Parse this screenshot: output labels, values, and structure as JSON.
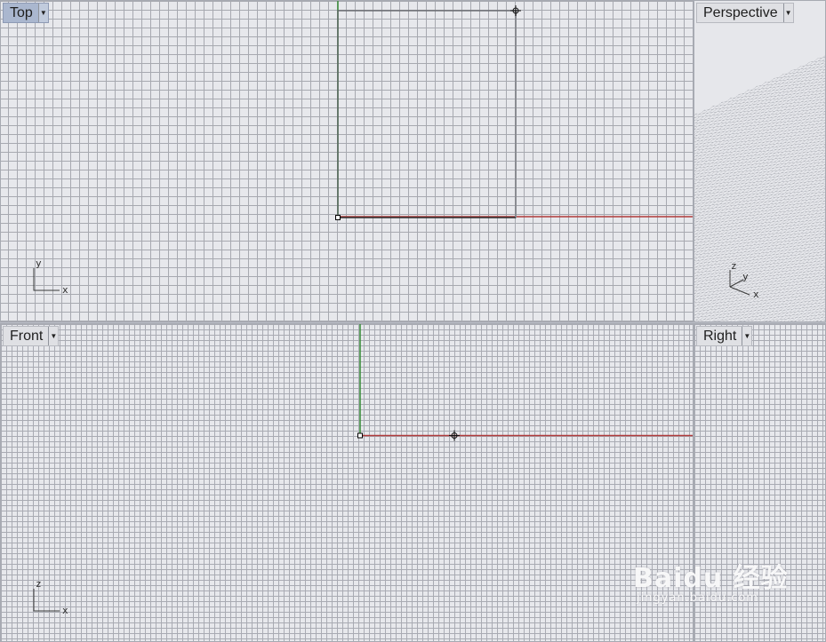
{
  "viewports": {
    "top": {
      "label": "Top",
      "axes": {
        "a": "y",
        "b": "x"
      }
    },
    "perspective": {
      "label": "Perspective",
      "axes": {
        "z": "z",
        "y": "y",
        "x": "x"
      }
    },
    "front": {
      "label": "Front",
      "axes": {
        "a": "z",
        "b": "x"
      }
    },
    "right": {
      "label": "Right"
    }
  },
  "watermark": {
    "brand": "Baidu 经验",
    "url": "jingyan.baidu.com"
  },
  "colors": {
    "x_axis": "#b03a3a",
    "y_axis": "#3f8f3f",
    "grid": "#a7a9b0",
    "background": "#e7e8ec",
    "active_label": "#aab7cf"
  },
  "icons": {
    "dropdown": "triangle-down-icon"
  }
}
